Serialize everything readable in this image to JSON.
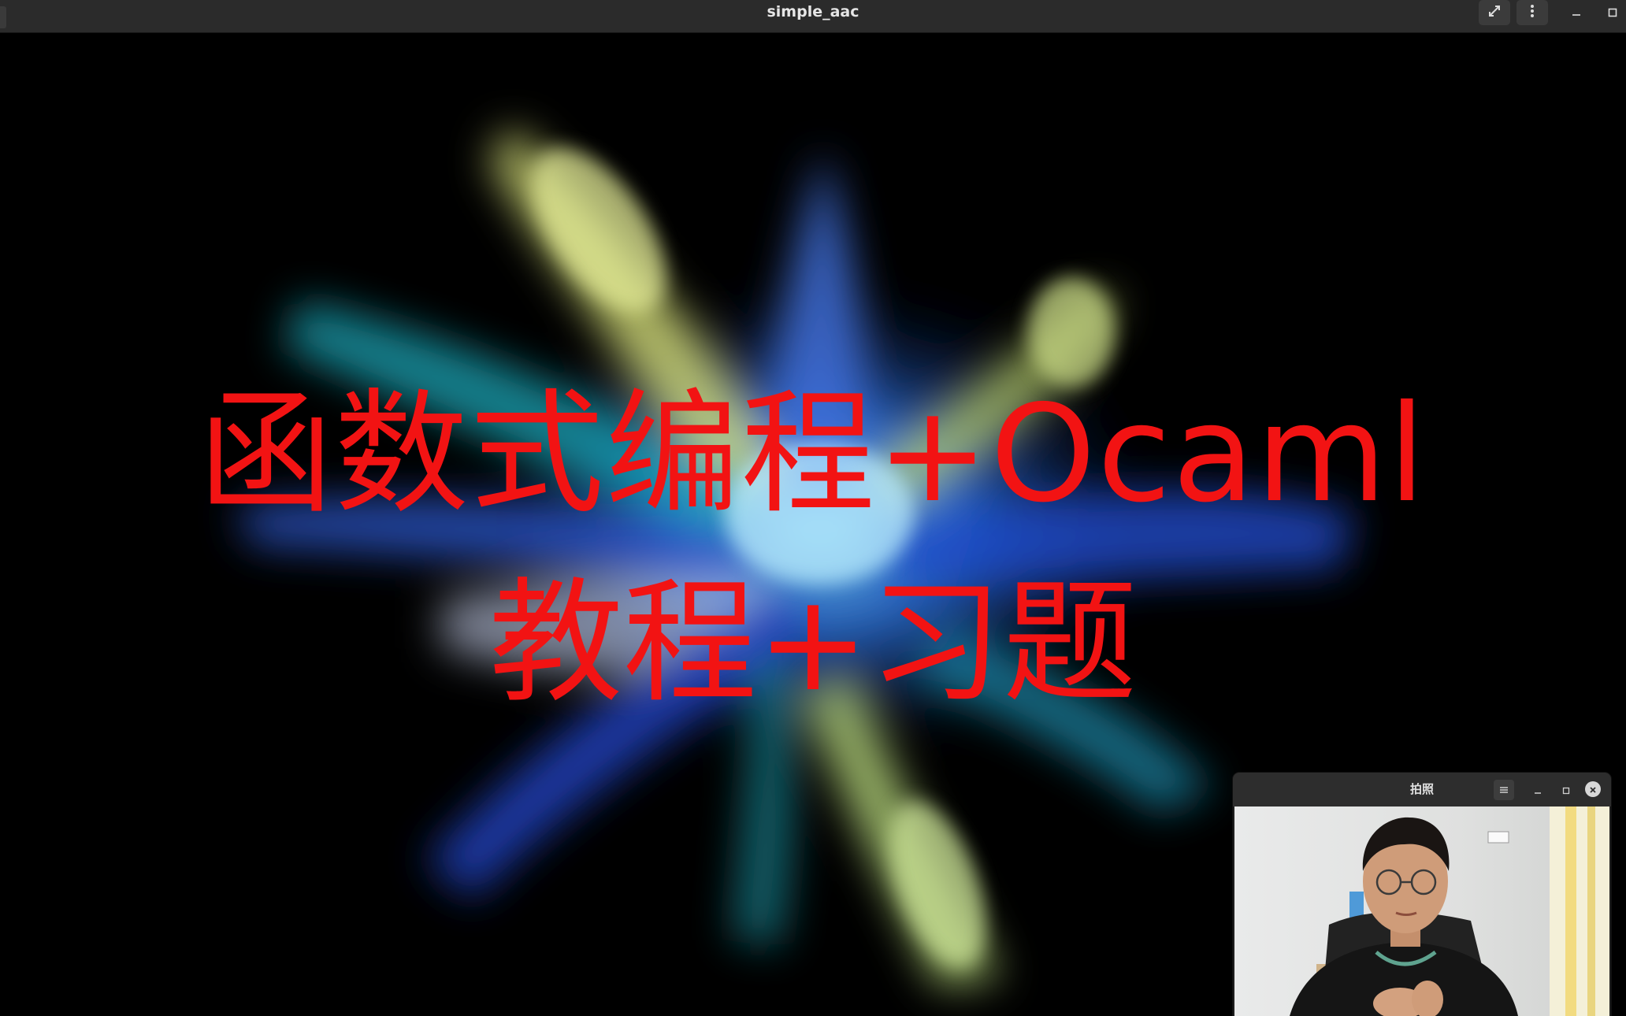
{
  "window": {
    "title": "simple_aac",
    "buttons": {
      "fullscreen": "fullscreen-icon",
      "menu": "kebab-menu-icon",
      "minimize": "minimize-icon",
      "maximize": "maximize-icon"
    }
  },
  "slide": {
    "line1": "函数式编程+Ocaml",
    "line2": "教程+习题",
    "text_color": "#f21313"
  },
  "camera_window": {
    "title": "拍照",
    "buttons": {
      "menu": "hamburger-menu-icon",
      "minimize": "minimize-icon",
      "maximize": "maximize-icon",
      "close": "close-icon"
    }
  }
}
